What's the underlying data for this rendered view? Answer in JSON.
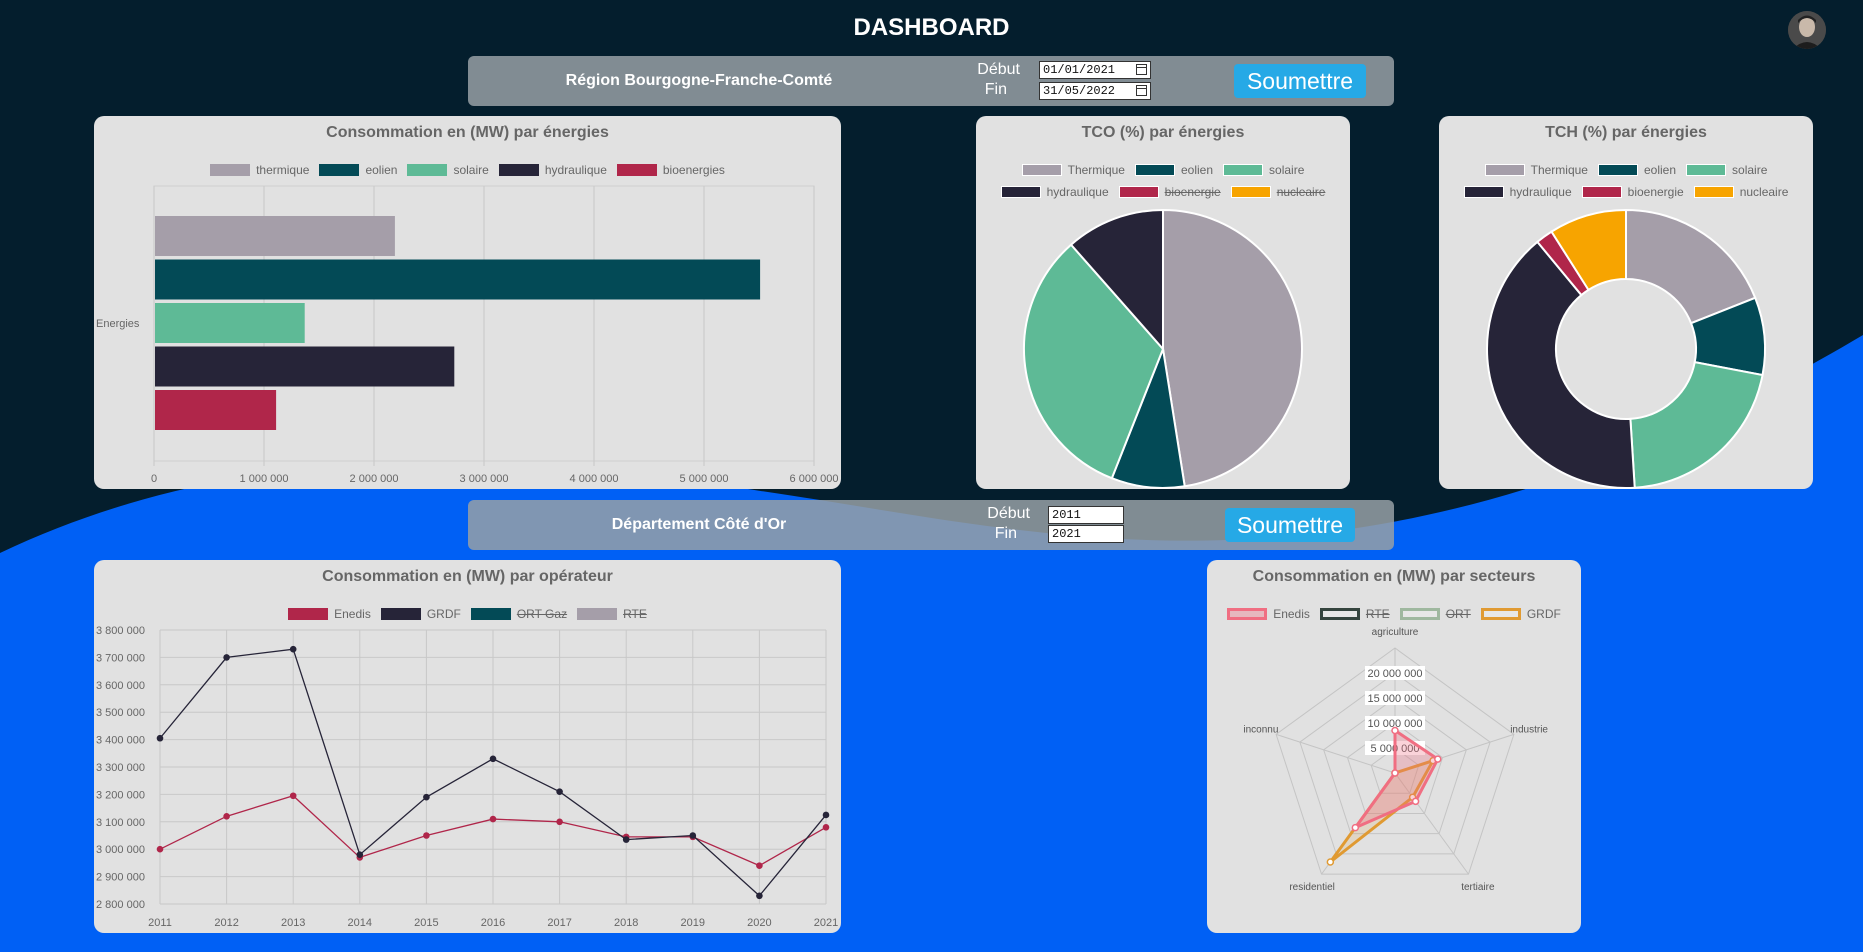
{
  "header": {
    "title": "DASHBOARD"
  },
  "filter_region": {
    "label": "Région Bourgogne-Franche-Comté",
    "start_label": "Début",
    "end_label": "Fin",
    "start_value": "01/01/2021",
    "end_value": "31/05/2022",
    "submit_label": "Soumettre"
  },
  "filter_dept": {
    "label": "Département Côté d'Or",
    "start_label": "Début",
    "end_label": "Fin",
    "start_value": "2011",
    "end_value": "2021",
    "submit_label": "Soumettre"
  },
  "colors": {
    "thermique": "#a59ea9",
    "eolien": "#034a56",
    "solaire": "#5eba96",
    "hydraulique": "#262438",
    "bioenergies": "#b0264a",
    "nucleaire": "#f7a400",
    "enedis": "#b0264a",
    "grdf": "#262438",
    "accent": "#26a9e6"
  },
  "chart_data": [
    {
      "id": "bar",
      "type": "bar",
      "orientation": "horizontal",
      "title": "Consommation en (MW) par énergies",
      "ylabel": "Energies",
      "categories": [
        "Energies"
      ],
      "series": [
        {
          "name": "thermique",
          "values": [
            2190000
          ]
        },
        {
          "name": "eolien",
          "values": [
            5510000
          ]
        },
        {
          "name": "solaire",
          "values": [
            1370000
          ]
        },
        {
          "name": "hydraulique",
          "values": [
            2730000
          ]
        },
        {
          "name": "bioenergies",
          "values": [
            1110000
          ]
        }
      ],
      "xlim": [
        0,
        6000000
      ],
      "xticks": [
        "0",
        "1 000 000",
        "2 000 000",
        "3 000 000",
        "4 000 000",
        "5 000 000",
        "6 000 000"
      ],
      "grid": true,
      "legend": "top"
    },
    {
      "id": "tco",
      "type": "pie",
      "title": "TCO (%) par énergies",
      "labels": [
        "Thermique",
        "eolien",
        "solaire",
        "hydraulique",
        "bioenergie",
        "nucleaire"
      ],
      "hidden": [
        "bioenergie",
        "nucleaire"
      ],
      "values": [
        47.5,
        8.5,
        32.5,
        11.5,
        0,
        0
      ],
      "legend": "top"
    },
    {
      "id": "tch",
      "type": "pie",
      "variant": "doughnut",
      "title": "TCH (%) par énergies",
      "labels": [
        "Thermique",
        "eolien",
        "solaire",
        "hydraulique",
        "bioenergie",
        "nucleaire"
      ],
      "hidden": [],
      "values": [
        19,
        9,
        21,
        40,
        2,
        9
      ],
      "legend": "top"
    },
    {
      "id": "line",
      "type": "line",
      "title": "Consommation en (MW) par opérateur",
      "x": [
        "2011",
        "2012",
        "2013",
        "2014",
        "2015",
        "2016",
        "2017",
        "2018",
        "2019",
        "2020",
        "2021"
      ],
      "series": [
        {
          "name": "Enedis",
          "values": [
            3000000,
            3120000,
            3195000,
            2970000,
            3050000,
            3110000,
            3100000,
            3045000,
            3045000,
            2940000,
            3080000
          ]
        },
        {
          "name": "GRDF",
          "values": [
            3405000,
            3700000,
            3730000,
            2980000,
            3190000,
            3330000,
            3210000,
            3035000,
            3050000,
            2830000,
            3125000
          ]
        }
      ],
      "legend_items": [
        {
          "name": "Enedis",
          "hidden": false
        },
        {
          "name": "GRDF",
          "hidden": false
        },
        {
          "name": "ORT Gaz",
          "hidden": true
        },
        {
          "name": "RTE",
          "hidden": true
        }
      ],
      "ylim": [
        2800000,
        3800000
      ],
      "yticks": [
        "3 800 000",
        "3 700 000",
        "3 600 000",
        "3 500 000",
        "3 400 000",
        "3 300 000",
        "3 200 000",
        "3 100 000",
        "3 000 000",
        "2 900 000",
        "2 800 000"
      ],
      "grid": true,
      "legend": "top"
    },
    {
      "id": "radar",
      "type": "radar",
      "title": "Consommation en (MW) par secteurs",
      "axes": [
        "agriculture",
        "industrie",
        "tertiaire",
        "residentiel",
        "inconnu"
      ],
      "rticks": [
        "5 000 000",
        "10 000 000",
        "15 000 000",
        "20 000 000"
      ],
      "rmax": 25000000,
      "series": [
        {
          "name": "Enedis",
          "values": [
            8500000,
            9000000,
            7000000,
            13500000,
            0
          ]
        },
        {
          "name": "GRDF",
          "values": [
            0,
            8000000,
            6000000,
            22000000,
            0
          ]
        }
      ],
      "legend_items": [
        {
          "name": "Enedis",
          "hidden": false
        },
        {
          "name": "RTE",
          "hidden": true
        },
        {
          "name": "ORT",
          "hidden": true
        },
        {
          "name": "GRDF",
          "hidden": false
        }
      ],
      "legend": "top"
    }
  ]
}
